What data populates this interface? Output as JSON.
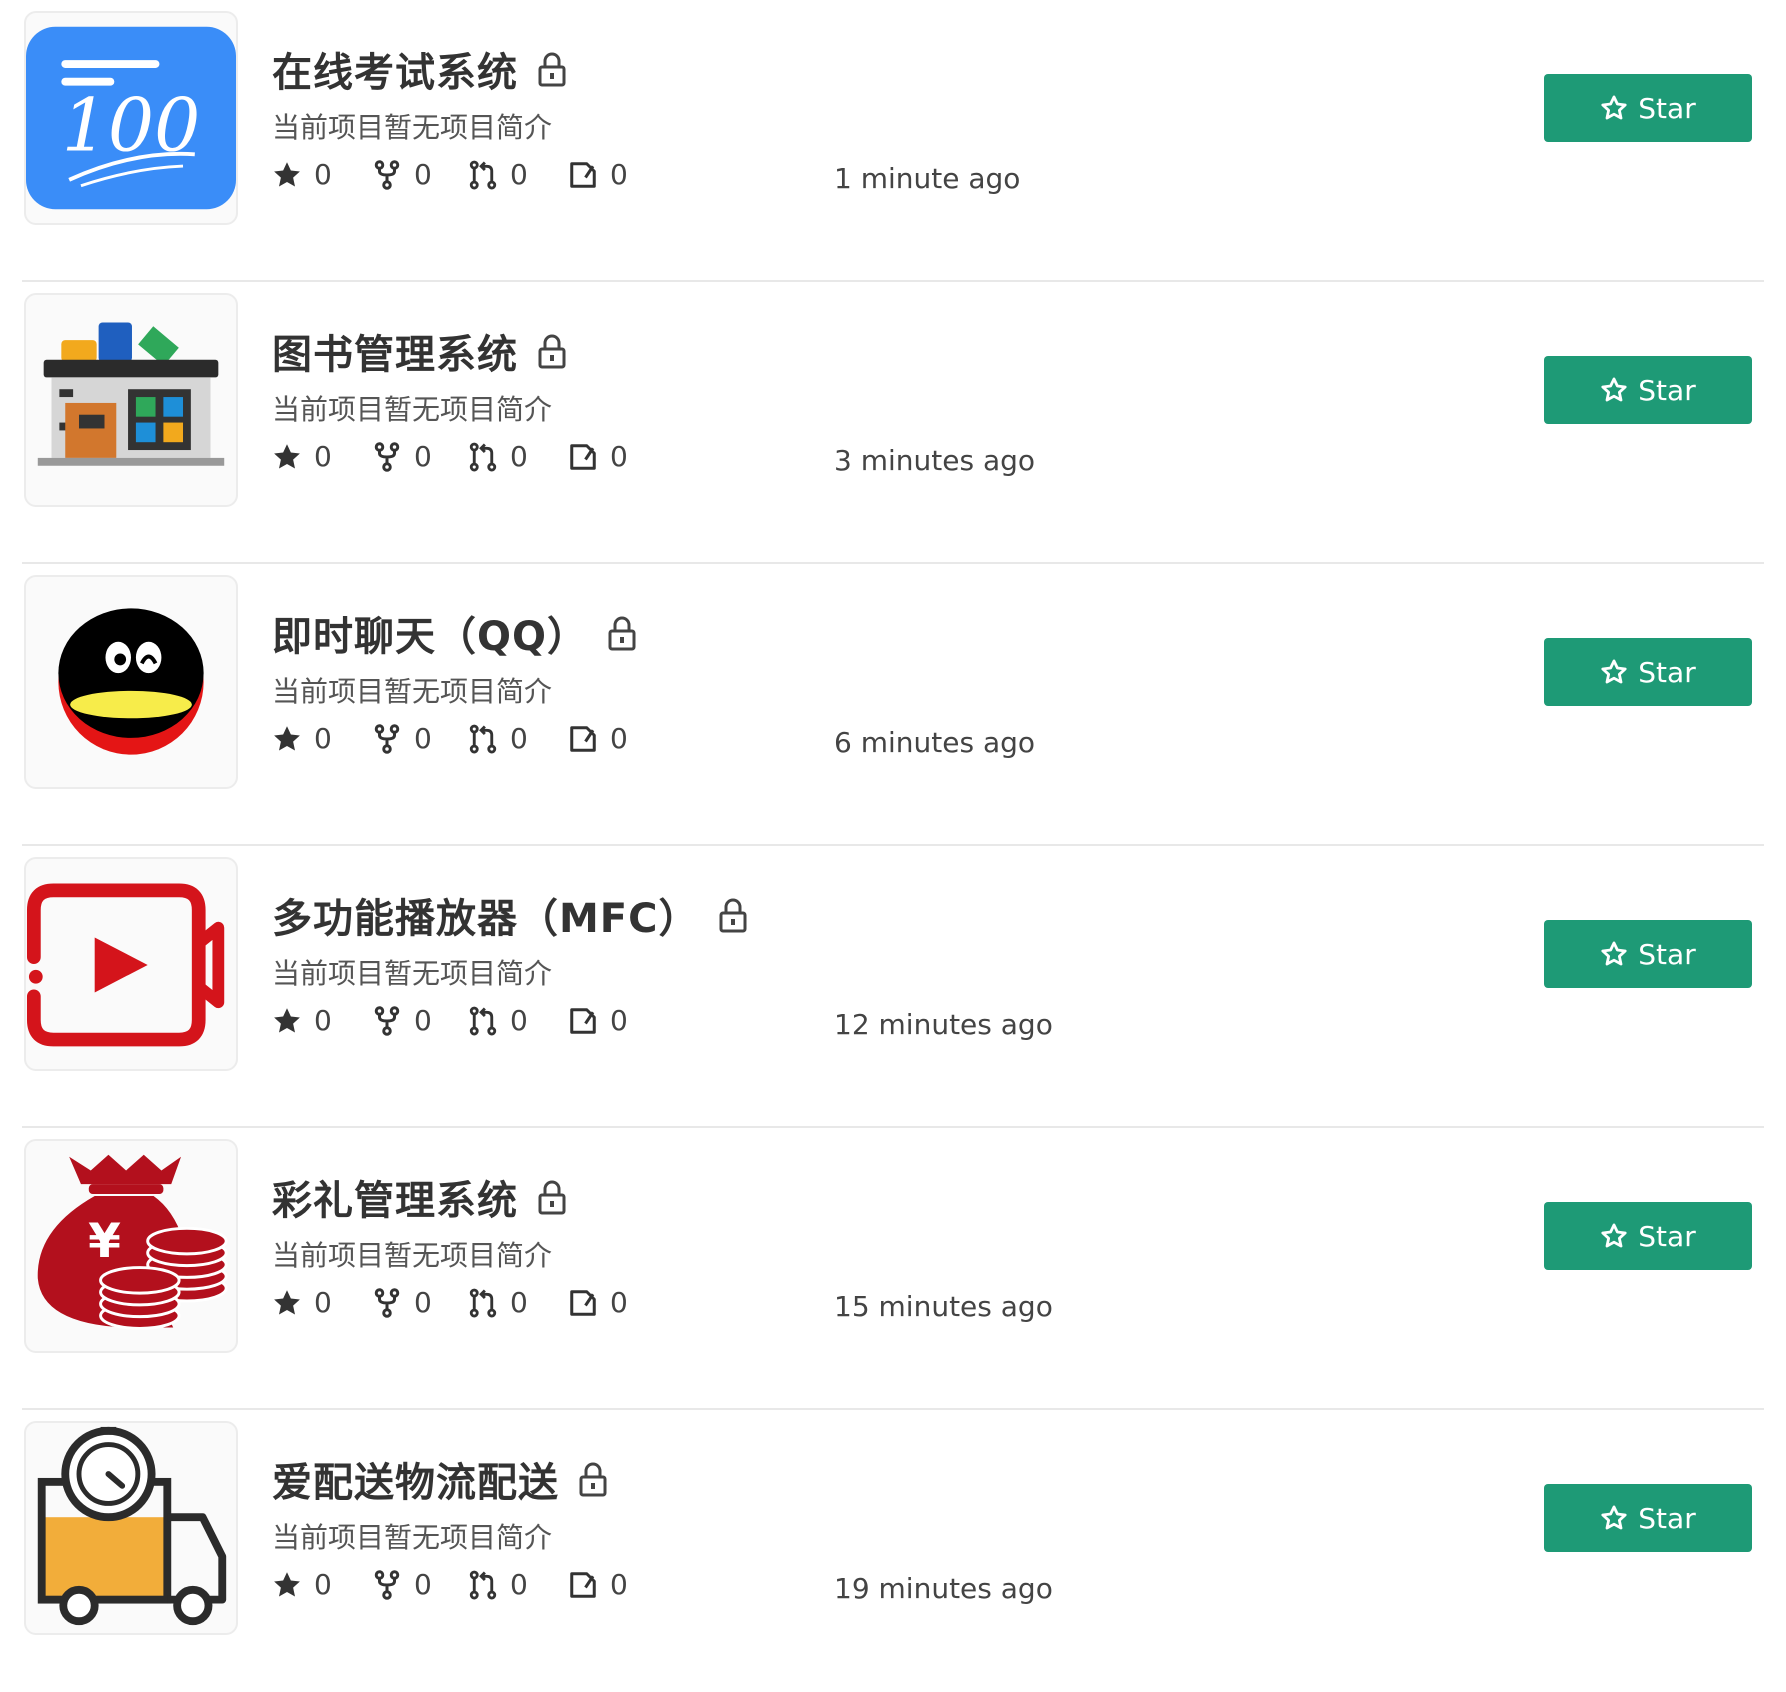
{
  "repos": [
    {
      "name": "在线考试系统",
      "description": "当前项目暂无项目简介",
      "stars": "0",
      "forks": "0",
      "pull_requests": "0",
      "issues": "0",
      "updated": "1 minute ago",
      "button": "Star",
      "logo": "100-score-logo"
    },
    {
      "name": "图书管理系统",
      "description": "当前项目暂无项目简介",
      "stars": "0",
      "forks": "0",
      "pull_requests": "0",
      "issues": "0",
      "updated": "3 minutes ago",
      "button": "Star",
      "logo": "library-building-logo"
    },
    {
      "name": "即时聊天（QQ）",
      "description": "当前项目暂无项目简介",
      "stars": "0",
      "forks": "0",
      "pull_requests": "0",
      "issues": "0",
      "updated": "6 minutes ago",
      "button": "Star",
      "logo": "qq-penguin-logo"
    },
    {
      "name": "多功能播放器（MFC）",
      "description": "当前项目暂无项目简介",
      "stars": "0",
      "forks": "0",
      "pull_requests": "0",
      "issues": "0",
      "updated": "12 minutes ago",
      "button": "Star",
      "logo": "video-player-logo"
    },
    {
      "name": "彩礼管理系统",
      "description": "当前项目暂无项目简介",
      "stars": "0",
      "forks": "0",
      "pull_requests": "0",
      "issues": "0",
      "updated": "15 minutes ago",
      "button": "Star",
      "logo": "money-bag-logo"
    },
    {
      "name": "爱配送物流配送",
      "description": "当前项目暂无项目简介",
      "stars": "0",
      "forks": "0",
      "pull_requests": "0",
      "issues": "0",
      "updated": "19 minutes ago",
      "button": "Star",
      "logo": "delivery-truck-logo"
    }
  ],
  "colors": {
    "star_button": "#1e9a76",
    "divider": "#e8e8e8",
    "text": "#333333"
  },
  "icons": {
    "lock": "lock-icon",
    "star": "star-icon",
    "fork": "fork-icon",
    "pull_request": "pull-request-icon",
    "issue": "issue-icon",
    "star_outline": "star-outline-icon"
  }
}
